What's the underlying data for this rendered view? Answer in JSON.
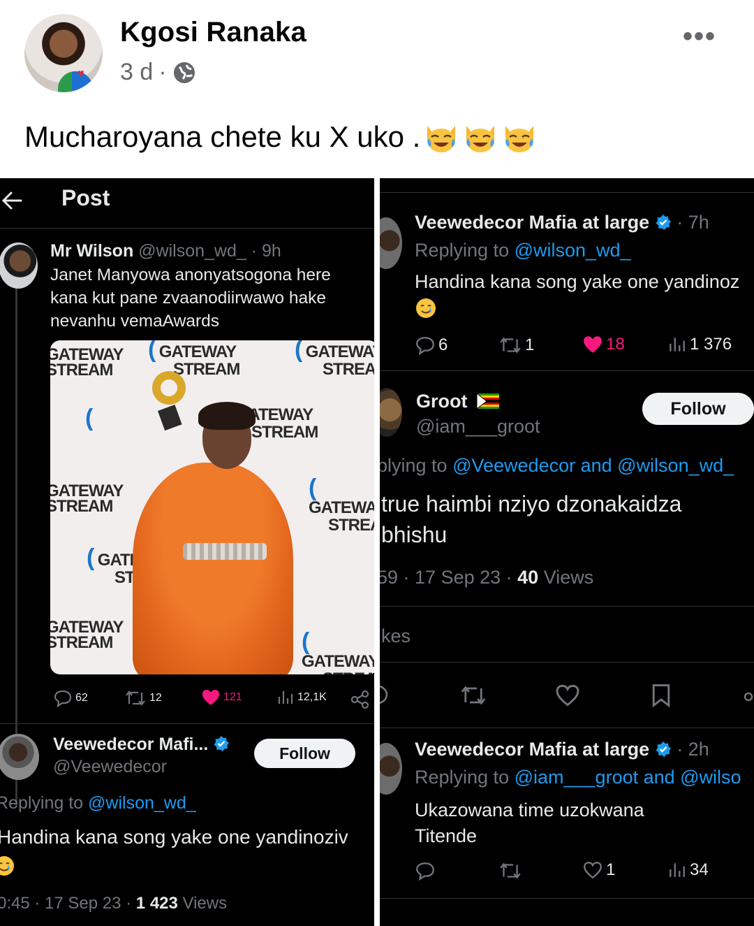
{
  "post": {
    "author": "Kgosi Ranaka",
    "time": "3 d",
    "separator": "·",
    "caption": "Mucharoyana chete ku X uko .",
    "caption_emojis": [
      "tears-of-joy-cat-emoji",
      "tears-of-joy-cat-emoji",
      "tears-of-joy-cat-emoji"
    ]
  },
  "left_shot": {
    "title": "Post",
    "tweet": {
      "name": "Mr Wilson",
      "handle": "@wilson_wd_",
      "time": "· 9h",
      "lines": [
        "Janet Manyowa anonyatsogona here",
        "kana kut pane zvaanodiirwawo hake",
        "nevanhu vemaAwards"
      ],
      "photo_logos": [
        "GATEWAY",
        "STREAM"
      ],
      "replies": "62",
      "reposts": "12",
      "likes": "121",
      "views": "12,1K"
    },
    "reply": {
      "name": "Veewedecor Mafi...",
      "handle": "@Veewedecor",
      "follow": "Follow",
      "replying_prefix": "Replying to ",
      "replying_to": "@wilson_wd_",
      "text": "Handina kana song yake one yandinoziv",
      "time": "0:45 · 17 Sep 23 · ",
      "views_count": "1 423",
      "views_label": " Views"
    }
  },
  "right_shot": {
    "reply1": {
      "name": "Veewedecor Mafia at large",
      "time": "· 7h",
      "replying_prefix": "Replying to ",
      "replying_to": "@wilson_wd_",
      "text": "Handina kana song yake one yandinoz",
      "replies": "6",
      "reposts": "1",
      "likes": "18",
      "views": "1 376"
    },
    "groot": {
      "name": "Groot",
      "handle": "@iam___groot",
      "follow": "Follow",
      "replying_prefix": "plying to ",
      "replying_to": "@Veewedecor and @wilson_wd_",
      "line1": "true haimbi nziyo dzonakaidza",
      "line2": "bhishu",
      "time": "59 · 17 Sep 23 · ",
      "views_count": "40",
      "views_label": " Views",
      "likes_label": "kes"
    },
    "reply3": {
      "name": "Veewedecor Mafia at large",
      "time": "· 2h",
      "replying_prefix": "Replying to ",
      "replying_to": "@iam___groot and @wilso",
      "line1": "Ukazowana time uzokwana",
      "line2": "Titende",
      "likes": "1",
      "views": "34"
    }
  },
  "colors": {
    "link": "#1d9bf0",
    "like": "#f91880",
    "muted": "#71767b",
    "facebook_meta": "#65676b"
  }
}
